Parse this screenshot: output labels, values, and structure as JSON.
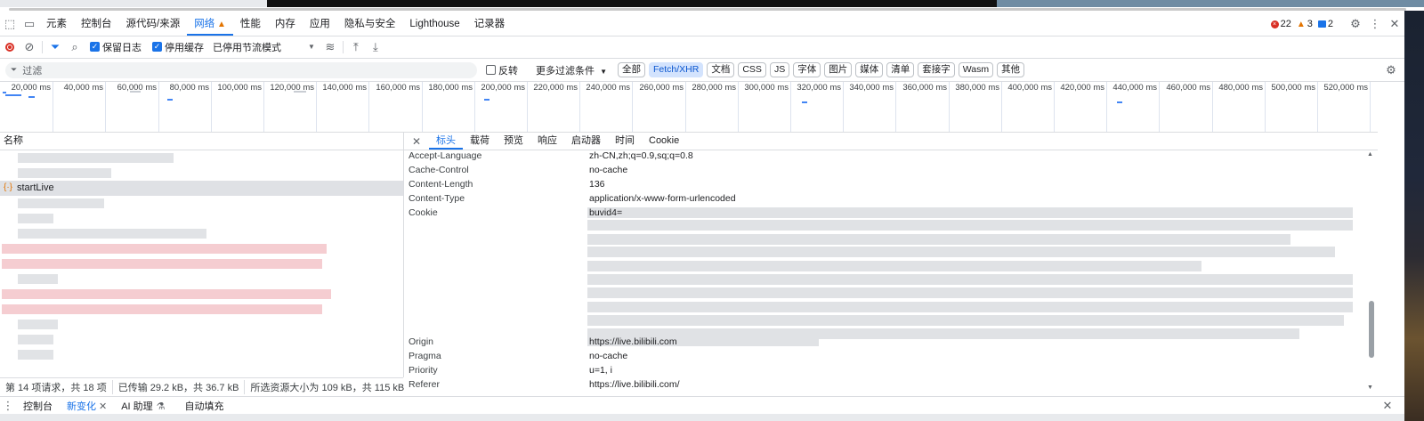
{
  "tabs": [
    "元素",
    "控制台",
    "源代码/来源",
    "网络",
    "性能",
    "内存",
    "应用",
    "隐私与安全",
    "Lighthouse",
    "记录器"
  ],
  "active_tab": "网络",
  "counts": {
    "errors": "22",
    "warnings": "3",
    "messages": "2"
  },
  "toolbar": {
    "preserve_log": "保留日志",
    "disable_cache": "停用缓存",
    "throttle": "已停用节流模式"
  },
  "filter": {
    "placeholder": "过滤",
    "invert": "反转",
    "more_filters": "更多过滤条件"
  },
  "filter_types": [
    "全部",
    "Fetch/XHR",
    "文档",
    "CSS",
    "JS",
    "字体",
    "图片",
    "媒体",
    "清单",
    "套接字",
    "Wasm",
    "其他"
  ],
  "selected_filter": "Fetch/XHR",
  "timeline_ticks": [
    "20,000 ms",
    "40,000 ms",
    "60,000 ms",
    "80,000 ms",
    "100,000 ms",
    "120,000 ms",
    "140,000 ms",
    "160,000 ms",
    "180,000 ms",
    "200,000 ms",
    "220,000 ms",
    "240,000 ms",
    "260,000 ms",
    "280,000 ms",
    "300,000 ms",
    "320,000 ms",
    "340,000 ms",
    "360,000 ms",
    "380,000 ms",
    "400,000 ms",
    "420,000 ms",
    "440,000 ms",
    "460,000 ms",
    "480,000 ms",
    "500,000 ms",
    "520,000 ms"
  ],
  "request_list": {
    "header": "名称",
    "selected_name": "startLive"
  },
  "status": {
    "requests": "第 14 项请求，共 18 项",
    "transferred": "已传输 29.2 kB，共 36.7 kB",
    "resources": "所选资源大小为 109 kB，共 115 kB"
  },
  "detail_tabs": [
    "标头",
    "载荷",
    "预览",
    "响应",
    "启动器",
    "时间",
    "Cookie"
  ],
  "active_detail_tab": "标头",
  "headers": [
    {
      "k": "Accept-Language",
      "v": "zh-CN,zh;q=0.9,sq;q=0.8"
    },
    {
      "k": "Cache-Control",
      "v": "no-cache"
    },
    {
      "k": "Content-Length",
      "v": "136"
    },
    {
      "k": "Content-Type",
      "v": "application/x-www-form-urlencoded"
    },
    {
      "k": "Cookie",
      "v": "buvid4="
    },
    {
      "k": "Origin",
      "v": "https://live.bilibili.com"
    },
    {
      "k": "Pragma",
      "v": "no-cache"
    },
    {
      "k": "Priority",
      "v": "u=1, i"
    },
    {
      "k": "Referer",
      "v": "https://live.bilibili.com/"
    }
  ],
  "drawer": {
    "console": "控制台",
    "whats_new": "新变化",
    "ai": "AI 助理",
    "autofill": "自动填充"
  }
}
